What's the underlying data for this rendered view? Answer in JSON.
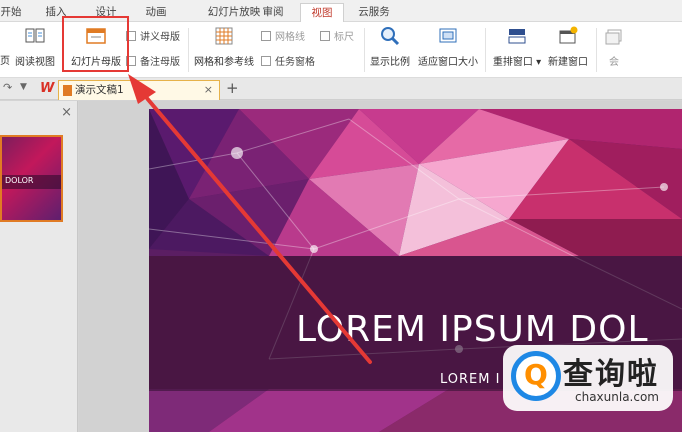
{
  "menu": {
    "tabs": [
      {
        "label": "开始"
      },
      {
        "label": "插入"
      },
      {
        "label": "设计"
      },
      {
        "label": "动画"
      },
      {
        "label": "幻灯片放映"
      },
      {
        "label": "审阅"
      },
      {
        "label": "视图"
      },
      {
        "label": "云服务"
      }
    ],
    "active": "视图"
  },
  "ribbon": {
    "page_label": "页",
    "reading_view": "阅读视图",
    "slide_master": "幻灯片母版",
    "handout_master": "讲义母版",
    "notes_master": "备注母版",
    "grid_guides": "网格和参考线",
    "gridlines": "网格线",
    "ruler": "标尺",
    "task_pane": "任务窗格",
    "zoom": "显示比例",
    "fit_window": "适应窗口大小",
    "arrange_windows": "重排窗口",
    "new_window": "新建窗口",
    "more": "会"
  },
  "tabstrip": {
    "app_logo": "W",
    "document_tab": "演示文稿1",
    "close_symbol": "×",
    "add_symbol": "+"
  },
  "left_pane": {
    "close_symbol": "×",
    "thumbnail_text": "DOLOR"
  },
  "slide": {
    "title": "LOREM IPSUM DOL",
    "subtitle": "LOREM I"
  },
  "watermark": {
    "logo_letter": "Q",
    "chinese": "查询啦",
    "site": "chaxunla.com"
  },
  "colors": {
    "highlight": "#e53935",
    "active_tab_text": "#c0392b",
    "accent_orange": "#e07b24"
  }
}
